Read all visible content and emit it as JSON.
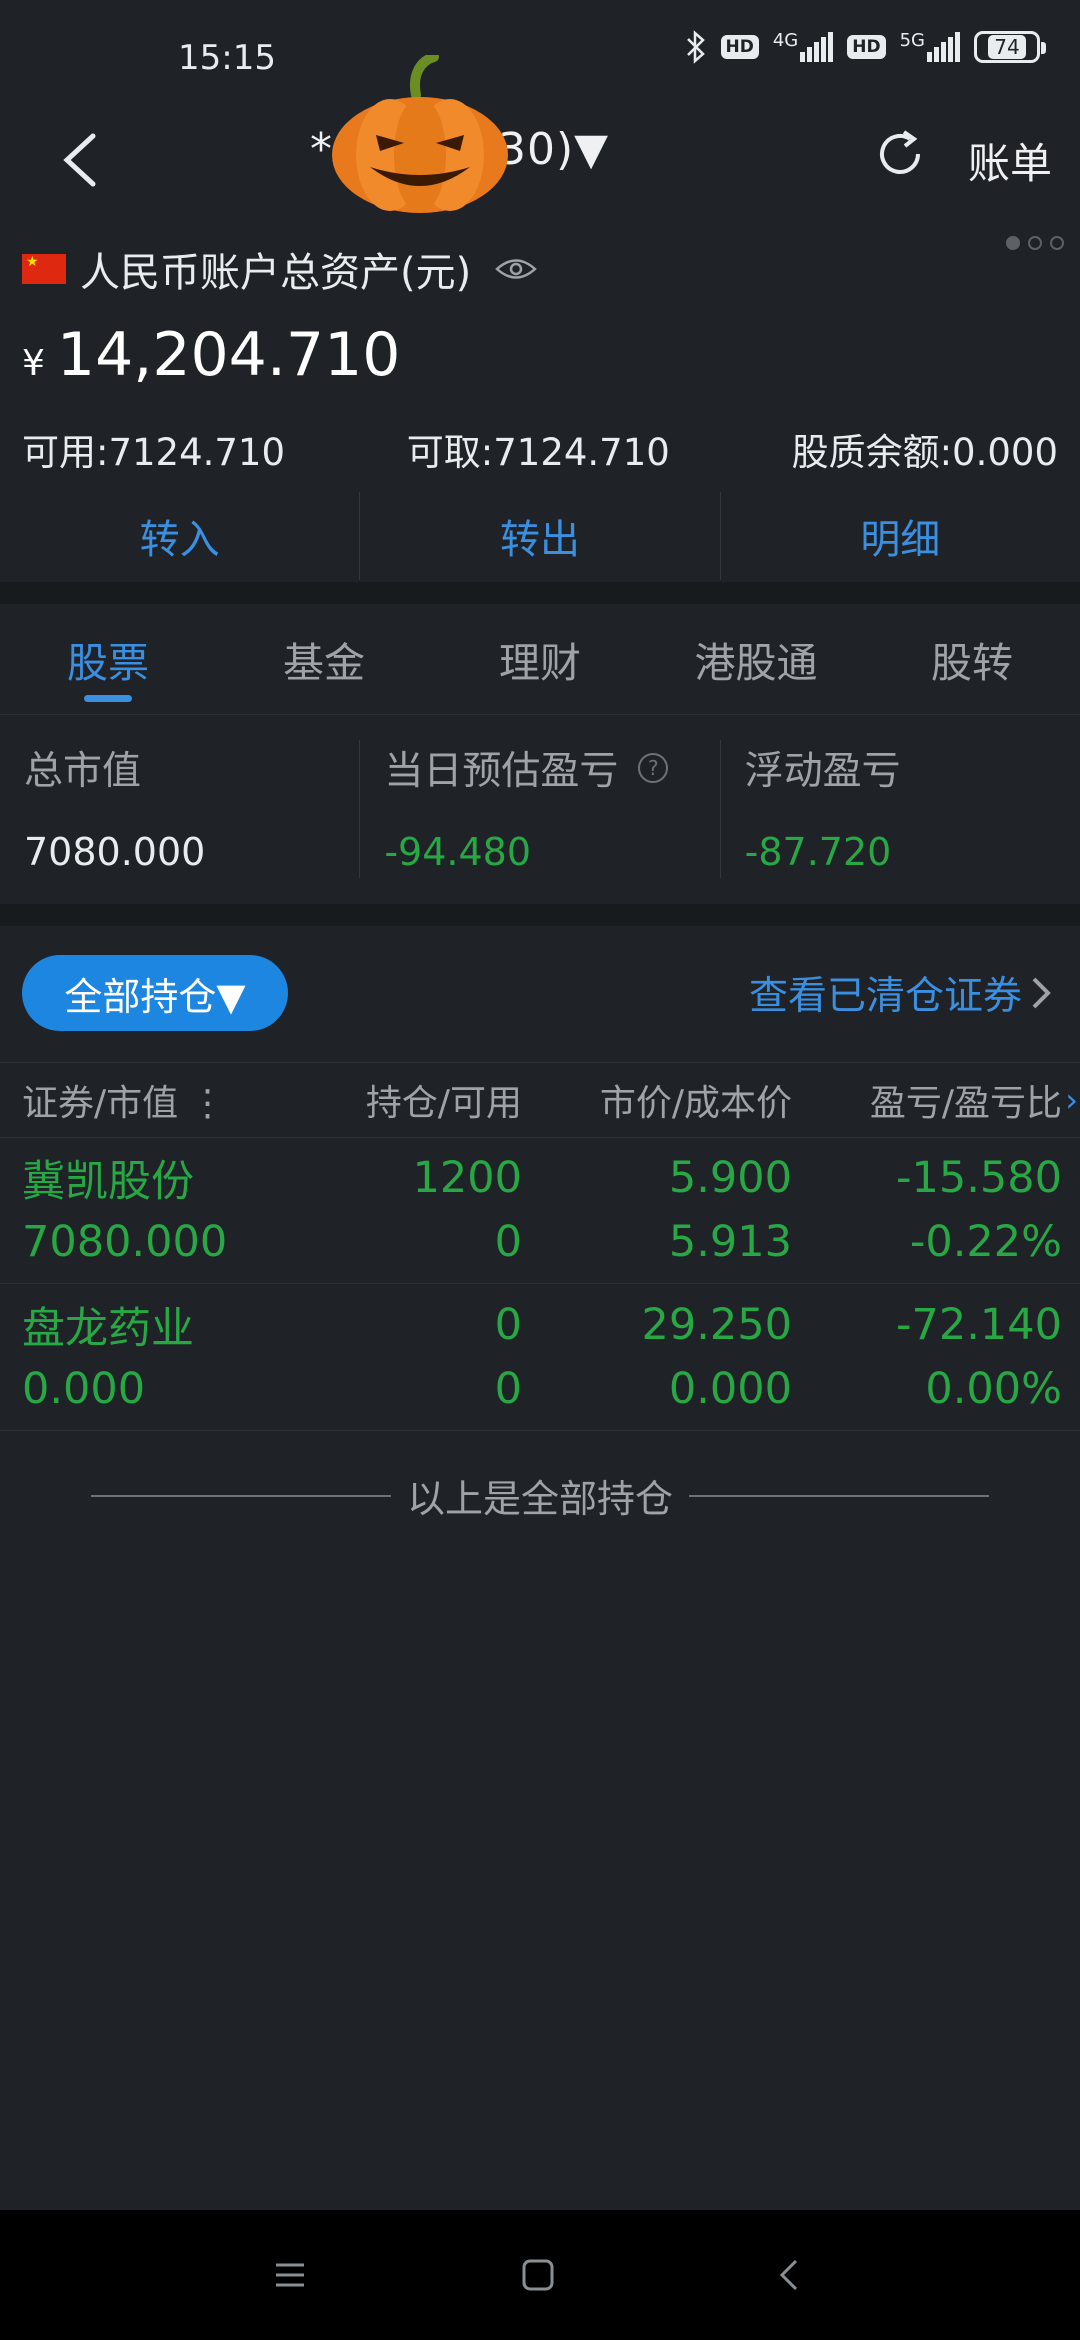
{
  "status_bar": {
    "time": "15:15",
    "icons": [
      "bluetooth-icon",
      "hd-icon",
      "4g-signal-icon",
      "hd-icon",
      "5g-signal-icon",
      "battery-icon"
    ],
    "hd_label": "HD",
    "net1": "4G",
    "net2": "5G",
    "battery": "74"
  },
  "header": {
    "account_title": "*            5****430)▼",
    "bill_label": "账单"
  },
  "account": {
    "label": "人民币账户总资产(元)",
    "currency_symbol": "¥",
    "total_assets": "14,204.710",
    "available": "可用:7124.710",
    "withdrawable": "可取:7124.710",
    "pledge_balance": "股质余额:0.000"
  },
  "actions": {
    "transfer_in": "转入",
    "transfer_out": "转出",
    "details": "明细"
  },
  "tabs": [
    "股票",
    "基金",
    "理财",
    "港股通",
    "股转"
  ],
  "stats": {
    "market_value_label": "总市值",
    "market_value": "7080.000",
    "daily_pnl_label": "当日预估盈亏",
    "daily_pnl": "-94.480",
    "floating_pnl_label": "浮动盈亏",
    "floating_pnl": "-87.720"
  },
  "filter": {
    "all_positions": "全部持仓▼",
    "view_cleared": "查看已清仓证券"
  },
  "table": {
    "headers": [
      "证券/市值",
      "持仓/可用",
      "市价/成本价",
      "盈亏/盈亏比"
    ],
    "rows": [
      {
        "name": "冀凯股份",
        "market_value": "7080.000",
        "position": "1200",
        "available": "0",
        "price": "5.900",
        "cost": "5.913",
        "pnl": "-15.580",
        "pnl_ratio": "-0.22%"
      },
      {
        "name": "盘龙药业",
        "market_value": "0.000",
        "position": "0",
        "available": "0",
        "price": "29.250",
        "cost": "0.000",
        "pnl": "-72.140",
        "pnl_ratio": "0.00%"
      }
    ]
  },
  "footer_note": "以上是全部持仓",
  "colors": {
    "background": "#1f2327",
    "accent_blue": "#3b8fe0",
    "loss_green": "#27a844"
  }
}
